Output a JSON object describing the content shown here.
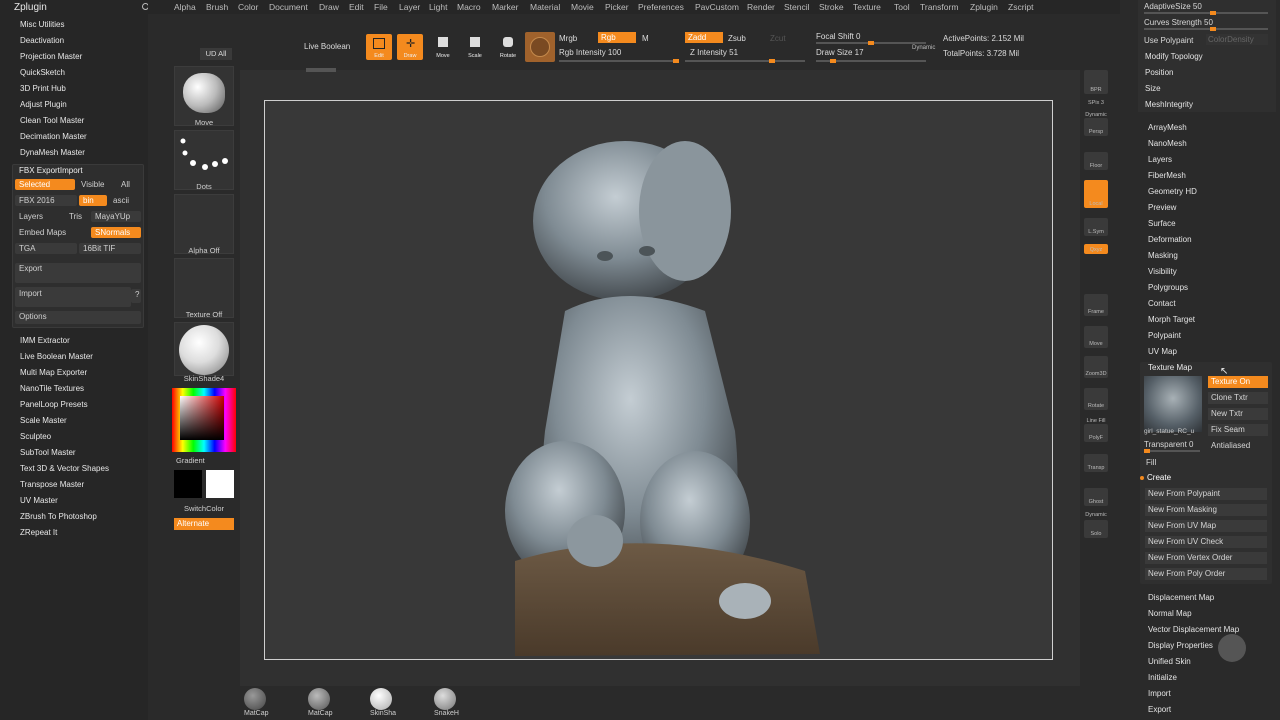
{
  "left_panel": {
    "title": "Zplugin",
    "items_top": [
      "Misc Utilities",
      "Deactivation",
      "Projection Master",
      "QuickSketch",
      "3D Print Hub",
      "Adjust Plugin",
      "Clean Tool Master",
      "Decimation Master",
      "DynaMesh Master"
    ],
    "fbx": {
      "title": "FBX ExportImport",
      "selected": "Selected",
      "visible": "Visible",
      "all": "All",
      "version": "FBX 2016",
      "bin": "bin",
      "ascii": "ascii",
      "layers": "Layers",
      "tris": "Tris",
      "mayayup": "MayaYUp",
      "embed_maps": "Embed Maps",
      "snormals": "SNormals",
      "tga": "TGA",
      "tif": "16Bit TIF",
      "export": "Export",
      "import": "Import",
      "help": "?",
      "options": "Options"
    },
    "items_bottom": [
      "IMM Extractor",
      "Live Boolean Master",
      "Multi Map Exporter",
      "NanoTile Textures",
      "PanelLoop Presets",
      "Scale Master",
      "Sculpteo",
      "SubTool Master",
      "Text 3D & Vector Shapes",
      "Transpose Master",
      "UV Master",
      "ZBrush To Photoshop",
      "ZRepeat It"
    ]
  },
  "menu": [
    "Alpha",
    "Brush",
    "Color",
    "Document",
    "Draw",
    "Edit",
    "File",
    "Layer",
    "Light",
    "Macro",
    "Marker",
    "Material",
    "Movie",
    "Picker",
    "Preferences",
    "PavCustom",
    "Render",
    "Stencil",
    "Stroke",
    "Texture",
    "Tool",
    "Transform",
    "Zplugin",
    "Zscript"
  ],
  "toolbar": {
    "live_boolean": "Live Boolean",
    "edit": "Edit",
    "draw": "Draw",
    "move": "Move",
    "scale": "Scale",
    "rotate": "Rotate",
    "mrgb": "Mrgb",
    "rgb": "Rgb",
    "m": "M",
    "rgb_intensity": "Rgb Intensity 100",
    "zadd": "Zadd",
    "zsub": "Zsub",
    "zcut": "Zcut",
    "z_intensity": "Z Intensity 51",
    "focal_shift": "Focal Shift 0",
    "draw_size": "Draw Size 17",
    "dynamic": "Dynamic",
    "active_points": "ActivePoints: 2.152 Mil",
    "total_points": "TotalPoints: 3.728 Mil"
  },
  "shelf": {
    "ud_all": "UD All",
    "move": "Move",
    "dots": "Dots",
    "alpha_off": "Alpha Off",
    "texture_off": "Texture Off",
    "material": "SkinShade4",
    "gradient": "Gradient",
    "switch_color": "SwitchColor",
    "alternate": "Alternate"
  },
  "right_tray": [
    "BPR",
    "SPix 3",
    "Dynamic",
    "Persp",
    "Floor",
    "Local",
    "L.Sym",
    "Qxyz",
    "Frame",
    "Move",
    "Zoom3D",
    "Rotate",
    "Line Fill",
    "PolyF",
    "Transp",
    "Ghost",
    "Dynamic",
    "Solo"
  ],
  "right_panel": {
    "adaptive_size": "AdaptiveSize 50",
    "curves_strength": "Curves Strength 50",
    "use_polypaint": "Use Polypaint",
    "color_density": "ColorDensity",
    "top_items": [
      "Modify Topology",
      "Position",
      "Size",
      "MeshIntegrity"
    ],
    "items": [
      "ArrayMesh",
      "NanoMesh",
      "Layers",
      "FiberMesh",
      "Geometry HD",
      "Preview",
      "Surface",
      "Deformation",
      "Masking",
      "Visibility",
      "Polygroups",
      "Contact",
      "Morph Target",
      "Polypaint",
      "UV Map"
    ],
    "texture_map": {
      "title": "Texture Map",
      "texture_on": "Texture On",
      "clone": "Clone Txtr",
      "new": "New Txtr",
      "fix_seam": "Fix Seam",
      "antialiased": "Antialiased",
      "thumb_label": "girl_statue_RC_u",
      "transparent": "Transparent 0",
      "fill": "Fill",
      "create": "Create",
      "buttons": [
        "New From Polypaint",
        "New From Masking",
        "New From UV Map",
        "New From UV Check",
        "New From Vertex Order",
        "New From Poly Order"
      ]
    },
    "bottom_items": [
      "Displacement Map",
      "Normal Map",
      "Vector Displacement Map",
      "Display Properties",
      "Unified Skin",
      "Initialize",
      "Import",
      "Export"
    ]
  },
  "bottom_shelf": [
    "MatCap",
    "MatCap",
    "SkinSha",
    "SnakeH"
  ],
  "colors": {
    "accent": "#f48a1e",
    "bg": "#2a2a2a",
    "canvas": "#383838"
  }
}
